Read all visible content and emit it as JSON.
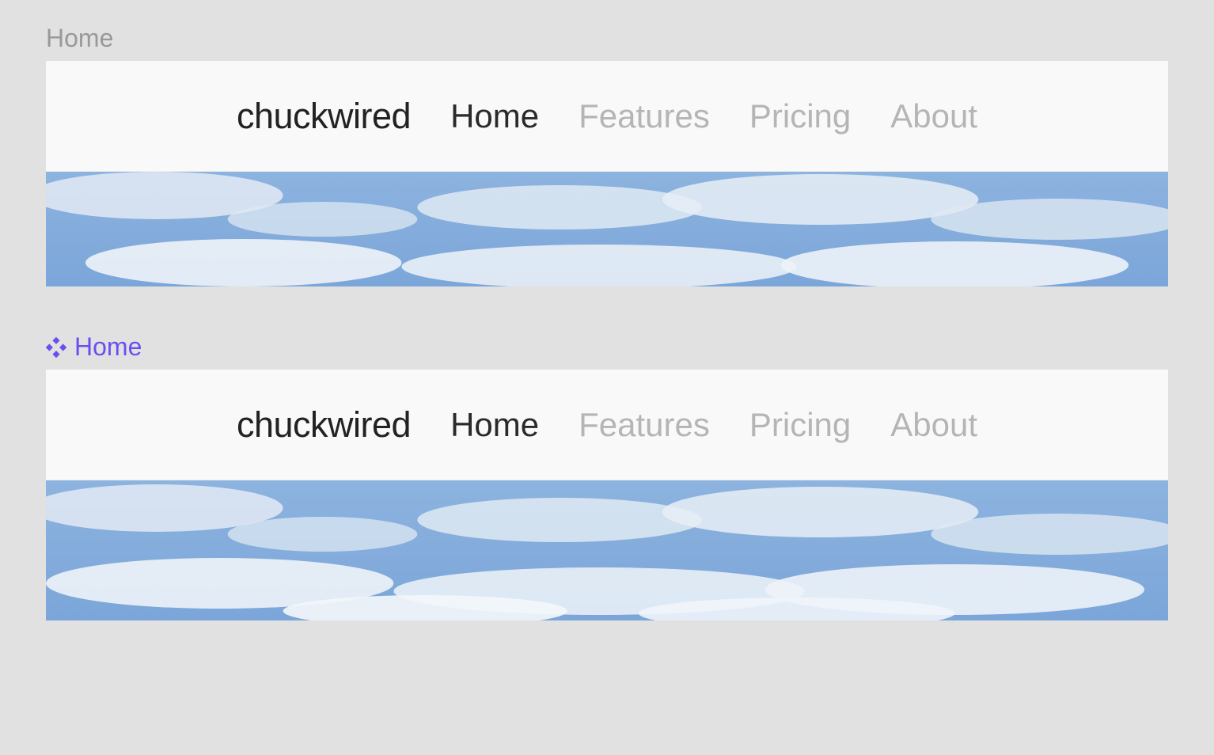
{
  "panels": [
    {
      "section_label": "Home",
      "has_icon": false,
      "nav": {
        "brand": "chuckwired",
        "links": [
          {
            "label": "Home",
            "active": true
          },
          {
            "label": "Features",
            "active": false
          },
          {
            "label": "Pricing",
            "active": false
          },
          {
            "label": "About",
            "active": false
          }
        ]
      }
    },
    {
      "section_label": "Home",
      "has_icon": true,
      "nav": {
        "brand": "chuckwired",
        "links": [
          {
            "label": "Home",
            "active": true
          },
          {
            "label": "Features",
            "active": false
          },
          {
            "label": "Pricing",
            "active": false
          },
          {
            "label": "About",
            "active": false
          }
        ]
      }
    }
  ]
}
